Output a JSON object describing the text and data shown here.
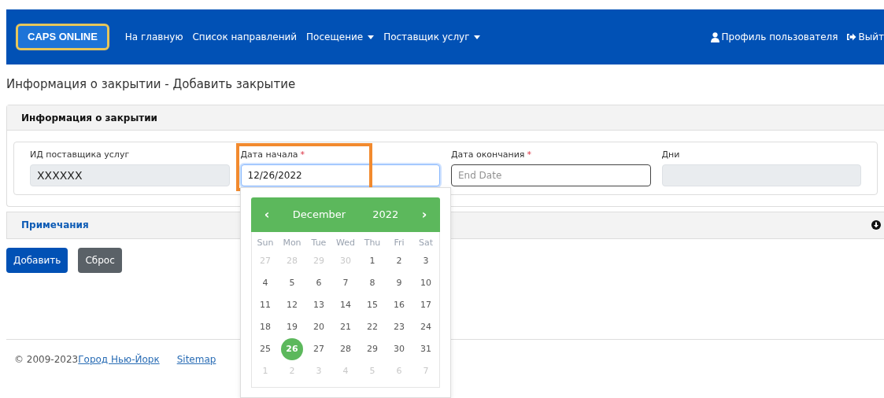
{
  "navbar": {
    "logo": "CAPS ONLINE",
    "links": [
      {
        "label": "На главную",
        "dropdown": false
      },
      {
        "label": "Список направлений",
        "dropdown": false
      },
      {
        "label": "Посещение",
        "dropdown": true
      },
      {
        "label": "Поставщик услуг",
        "dropdown": true
      }
    ],
    "profile": "Профиль пользователя",
    "logout": "Выйт"
  },
  "page_title": "Информация о закрытии - Добавить закрытие",
  "card": {
    "header": "Информация о закрытии",
    "fields": [
      {
        "label": "ИД поставщика услуг",
        "value": "XXXXXX",
        "readonly": true,
        "focused": false
      },
      {
        "label": "Дата начала",
        "required_mark": "*",
        "value": "12/26/2022",
        "readonly": false,
        "focused": true
      },
      {
        "label": "Дата окончания",
        "required_mark": "*",
        "placeholder": "End Date",
        "readonly": false,
        "focused": false
      },
      {
        "label": "Дни",
        "readonly": true,
        "focused": false
      }
    ]
  },
  "notes": {
    "title": "Примечания",
    "expanded": false
  },
  "buttons": [
    {
      "label": "Добавить",
      "kind": "primary"
    },
    {
      "label": "Сброс",
      "kind": "secondary"
    }
  ],
  "datepicker": {
    "prev": "‹",
    "month": "December",
    "year": "2022",
    "next": "›",
    "weekdays": [
      "Sun",
      "Mon",
      "Tue",
      "Wed",
      "Thu",
      "Fri",
      "Sat"
    ],
    "weeks": [
      [
        {
          "day": "27",
          "muted": true,
          "selected": false
        },
        {
          "day": "28",
          "muted": true,
          "selected": false
        },
        {
          "day": "29",
          "muted": true,
          "selected": false
        },
        {
          "day": "30",
          "muted": true,
          "selected": false
        },
        {
          "day": "1",
          "muted": false,
          "selected": false
        },
        {
          "day": "2",
          "muted": false,
          "selected": false
        },
        {
          "day": "3",
          "muted": false,
          "selected": false
        }
      ],
      [
        {
          "day": "4",
          "muted": false,
          "selected": false
        },
        {
          "day": "5",
          "muted": false,
          "selected": false
        },
        {
          "day": "6",
          "muted": false,
          "selected": false
        },
        {
          "day": "7",
          "muted": false,
          "selected": false
        },
        {
          "day": "8",
          "muted": false,
          "selected": false
        },
        {
          "day": "9",
          "muted": false,
          "selected": false
        },
        {
          "day": "10",
          "muted": false,
          "selected": false
        }
      ],
      [
        {
          "day": "11",
          "muted": false,
          "selected": false
        },
        {
          "day": "12",
          "muted": false,
          "selected": false
        },
        {
          "day": "13",
          "muted": false,
          "selected": false
        },
        {
          "day": "14",
          "muted": false,
          "selected": false
        },
        {
          "day": "15",
          "muted": false,
          "selected": false
        },
        {
          "day": "16",
          "muted": false,
          "selected": false
        },
        {
          "day": "17",
          "muted": false,
          "selected": false
        }
      ],
      [
        {
          "day": "18",
          "muted": false,
          "selected": false
        },
        {
          "day": "19",
          "muted": false,
          "selected": false
        },
        {
          "day": "20",
          "muted": false,
          "selected": false
        },
        {
          "day": "21",
          "muted": false,
          "selected": false
        },
        {
          "day": "22",
          "muted": false,
          "selected": false
        },
        {
          "day": "23",
          "muted": false,
          "selected": false
        },
        {
          "day": "24",
          "muted": false,
          "selected": false
        }
      ],
      [
        {
          "day": "25",
          "muted": false,
          "selected": false
        },
        {
          "day": "26",
          "muted": false,
          "selected": true
        },
        {
          "day": "27",
          "muted": false,
          "selected": false
        },
        {
          "day": "28",
          "muted": false,
          "selected": false
        },
        {
          "day": "29",
          "muted": false,
          "selected": false
        },
        {
          "day": "30",
          "muted": false,
          "selected": false
        },
        {
          "day": "31",
          "muted": false,
          "selected": false
        }
      ],
      [
        {
          "day": "1",
          "muted": true,
          "selected": false
        },
        {
          "day": "2",
          "muted": true,
          "selected": false
        },
        {
          "day": "3",
          "muted": true,
          "selected": false
        },
        {
          "day": "4",
          "muted": true,
          "selected": false
        },
        {
          "day": "5",
          "muted": true,
          "selected": false
        },
        {
          "day": "6",
          "muted": true,
          "selected": false
        },
        {
          "day": "7",
          "muted": true,
          "selected": false
        }
      ]
    ]
  },
  "footer": {
    "copyright": "© 2009-2023",
    "links": [
      "Город Нью-Йорк",
      "Sitemap"
    ]
  }
}
